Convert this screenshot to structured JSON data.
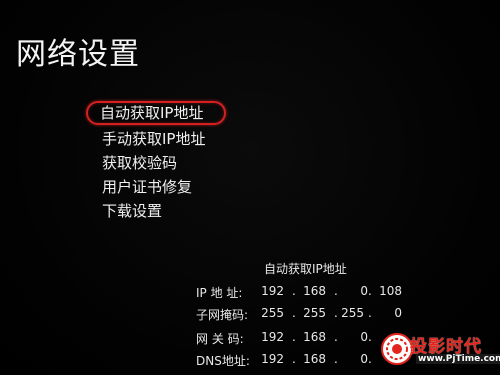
{
  "page": {
    "title": "网络设置"
  },
  "menu": {
    "items": [
      {
        "label": "自动获取IP地址",
        "selected": true
      },
      {
        "label": "手动获取IP地址",
        "selected": false
      },
      {
        "label": "获取校验码",
        "selected": false
      },
      {
        "label": "用户证书修复",
        "selected": false
      },
      {
        "label": "下载设置",
        "selected": false
      }
    ],
    "highlight_color": "#d42020"
  },
  "network_info": {
    "title": "自动获取IP地址",
    "rows": [
      {
        "label": "IP  地  址:",
        "octets": [
          "192",
          "168",
          "0",
          "108"
        ]
      },
      {
        "label": "子网掩码:",
        "octets": [
          "255",
          "255",
          "255",
          "0"
        ]
      },
      {
        "label": "网  关  码:",
        "octets": [
          "192",
          "168",
          "0",
          ""
        ]
      },
      {
        "label": "DNS地址:",
        "octets": [
          "192",
          "168",
          "0",
          ""
        ]
      }
    ]
  },
  "watermark": {
    "brand": "投影时代",
    "url": "www.PjTime.com",
    "brand_color": "#e2241c"
  }
}
